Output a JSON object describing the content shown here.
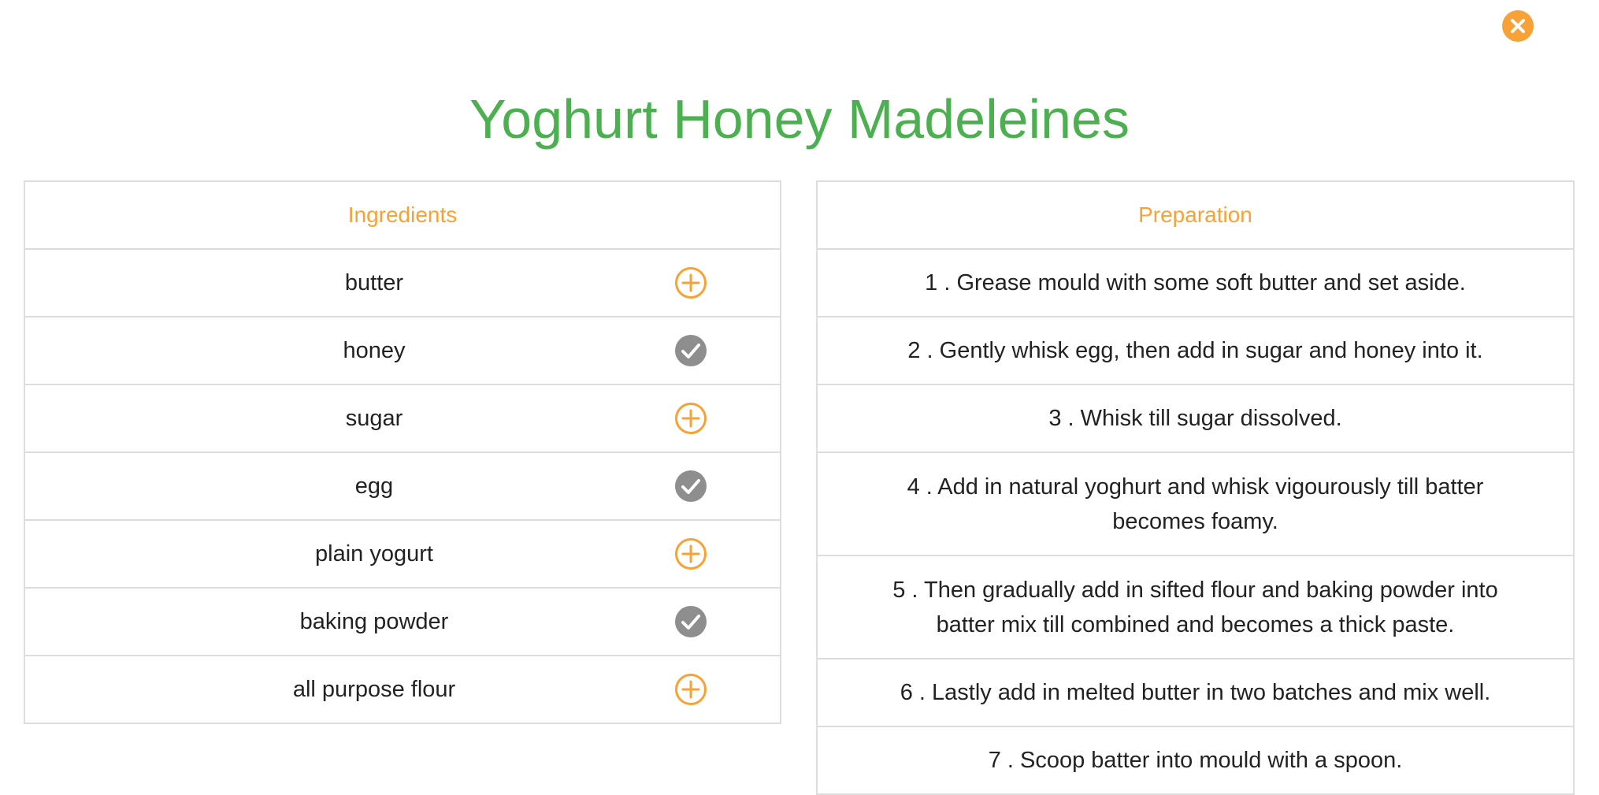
{
  "page": {
    "title": "Yoghurt Honey Madeleines",
    "close_icon": "close-icon"
  },
  "colors": {
    "title": "#4CAF50",
    "header": "#F7A236",
    "accent": "#F7A236",
    "checked": "#8E8E8E",
    "border": "#DDDDDD"
  },
  "ingredients": {
    "header": "Ingredients",
    "items": [
      {
        "name": "butter",
        "status": "add",
        "icon": "plus-circle-icon"
      },
      {
        "name": "honey",
        "status": "checked",
        "icon": "check-circle-icon"
      },
      {
        "name": "sugar",
        "status": "add",
        "icon": "plus-circle-icon"
      },
      {
        "name": "egg",
        "status": "checked",
        "icon": "check-circle-icon"
      },
      {
        "name": "plain yogurt",
        "status": "add",
        "icon": "plus-circle-icon"
      },
      {
        "name": "baking powder",
        "status": "checked",
        "icon": "check-circle-icon"
      },
      {
        "name": "all purpose flour",
        "status": "add",
        "icon": "plus-circle-icon"
      }
    ]
  },
  "preparation": {
    "header": "Preparation",
    "steps": [
      "1 . Grease mould with some soft butter and set aside.",
      "2 . Gently whisk egg, then add in sugar and honey into it.",
      "3 . Whisk till sugar dissolved.",
      "4 . Add in natural yoghurt and whisk vigourously till batter becomes foamy.",
      "5 . Then gradually add in sifted flour and baking powder into batter mix till combined and becomes a thick paste.",
      "6 . Lastly add in melted butter in two batches and mix well.",
      "7 . Scoop batter into mould with a spoon."
    ]
  }
}
